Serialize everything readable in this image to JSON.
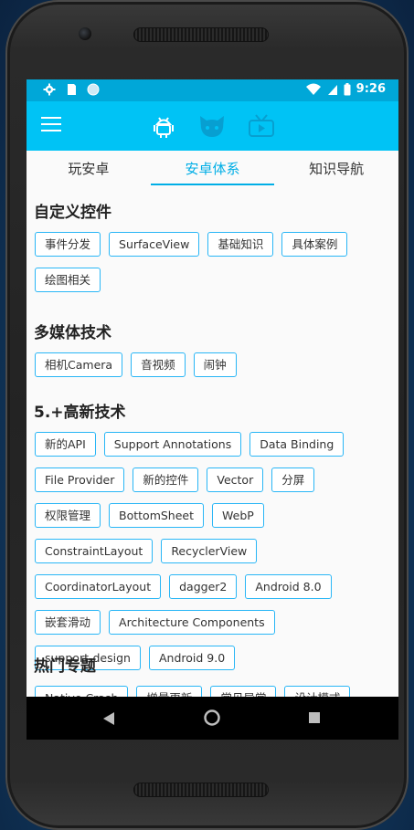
{
  "status_bar": {
    "time": "9:26"
  },
  "toolbar": {
    "menu_icon": "menu-icon",
    "icons": [
      "android-icon",
      "cat-icon",
      "tv-icon"
    ],
    "accent": "#00c3f5"
  },
  "tabs": [
    {
      "label": "玩安卓",
      "active": false
    },
    {
      "label": "安卓体系",
      "active": true
    },
    {
      "label": "知识导航",
      "active": false
    }
  ],
  "sections": [
    {
      "title": "自定义控件",
      "chips": [
        "事件分发",
        "SurfaceView",
        "基础知识",
        "具体案例",
        "绘图相关"
      ]
    },
    {
      "title": "多媒体技术",
      "chips": [
        "相机Camera",
        "音视频",
        "闹钟"
      ]
    },
    {
      "title": "5.+高新技术",
      "chips": [
        "新的API",
        "Support Annotations",
        "Data Binding",
        "File Provider",
        "新的控件",
        "Vector",
        "分屏",
        "权限管理",
        "BottomSheet",
        "WebP",
        "ConstraintLayout",
        "RecyclerView",
        "CoordinatorLayout",
        "dagger2",
        "Android 8.0",
        "嵌套滑动",
        "Architecture Components",
        "support-design",
        "Android 9.0"
      ]
    },
    {
      "title": "热门专题",
      "chips": [
        "Native Crash",
        "增量更新",
        "常见异常",
        "设计模式"
      ]
    }
  ],
  "nav_bar": [
    "back-icon",
    "home-icon",
    "recents-icon"
  ]
}
